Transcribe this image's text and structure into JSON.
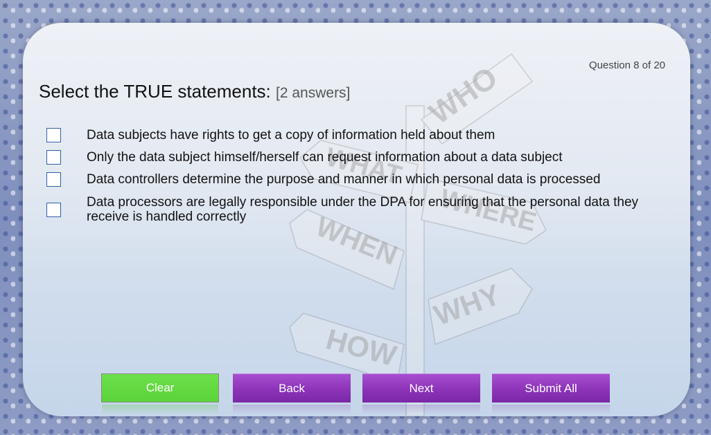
{
  "corner": {
    "icon": "double-chevron-right-icon",
    "glyph": "»"
  },
  "quiz": {
    "counter": "Question 8 of 20",
    "question": "Select the TRUE statements:",
    "hint": "[2 answers]",
    "options": [
      {
        "label": "Data subjects have rights to get a copy of information held about them",
        "checked": false
      },
      {
        "label": "Only the data subject himself/herself can request information about a data subject",
        "checked": false
      },
      {
        "label": "Data controllers determine the purpose and manner in which personal data is processed",
        "checked": false
      },
      {
        "label": "Data processors are legally responsible under the DPA for ensuring that the personal data they receive is handled correctly",
        "checked": false
      }
    ]
  },
  "signpost": {
    "labels": [
      "WHO",
      "WHAT",
      "WHERE",
      "WHEN",
      "WHY",
      "HOW"
    ]
  },
  "buttons": {
    "clear": "Clear",
    "back": "Back",
    "next": "Next",
    "submit": "Submit All"
  },
  "colors": {
    "clear_button": "#5fd63e",
    "nav_button": "#8c33b8",
    "checkbox_border": "#2d5fa8"
  }
}
